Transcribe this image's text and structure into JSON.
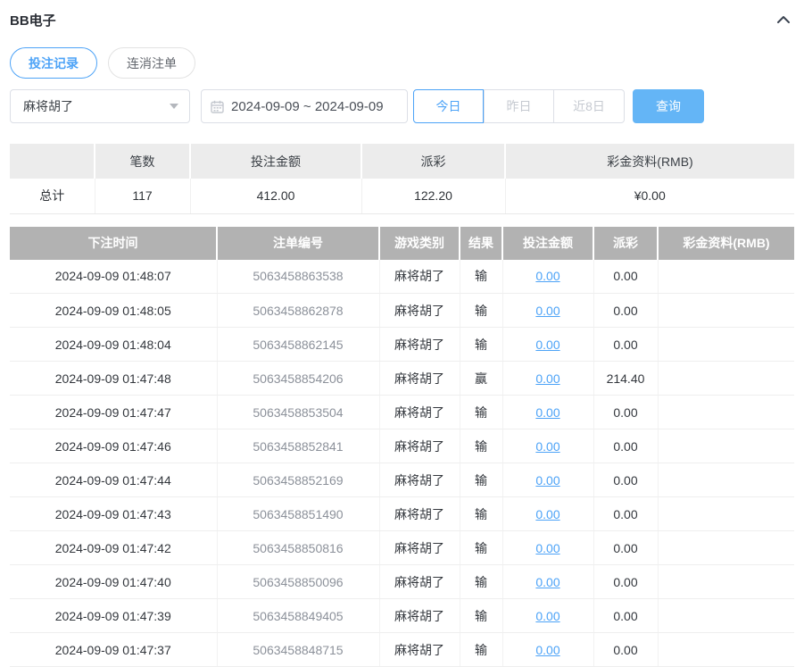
{
  "colors": {
    "accent_blue": "#4da3f7",
    "search_button_blue": "#64b5f6",
    "table_header_gray": "#b2b2b2",
    "summary_header_gray": "#ececec"
  },
  "header": {
    "title": "BB电子",
    "collapse_icon": "chevron-up"
  },
  "tabs": [
    {
      "label": "投注记录",
      "active": true
    },
    {
      "label": "连消注单",
      "active": false
    }
  ],
  "filters": {
    "game_select": {
      "value": "麻将胡了",
      "caret_icon": "caret-down"
    },
    "date_range": {
      "value": "2024-09-09 ~ 2024-09-09",
      "icon": "calendar"
    },
    "quick_buttons": [
      {
        "label": "今日",
        "active": true
      },
      {
        "label": "昨日",
        "active": false
      },
      {
        "label": "近8日",
        "active": false
      }
    ],
    "search_label": "查询"
  },
  "summary": {
    "headers": [
      "",
      "笔数",
      "投注金额",
      "派彩",
      "彩金资料(RMB)"
    ],
    "row": {
      "label": "总计",
      "count": "117",
      "bet_amount": "412.00",
      "payout": "122.20",
      "bonus": "¥0.00"
    }
  },
  "table": {
    "headers": [
      "下注时间",
      "注单编号",
      "游戏类别",
      "结果",
      "投注金额",
      "派彩",
      "彩金资料(RMB)"
    ],
    "rows": [
      {
        "time": "2024-09-09 01:48:07",
        "order_no": "5063458863538",
        "game": "麻将胡了",
        "result": "输",
        "bet": "0.00",
        "payout": "0.00",
        "bonus": ""
      },
      {
        "time": "2024-09-09 01:48:05",
        "order_no": "5063458862878",
        "game": "麻将胡了",
        "result": "输",
        "bet": "0.00",
        "payout": "0.00",
        "bonus": ""
      },
      {
        "time": "2024-09-09 01:48:04",
        "order_no": "5063458862145",
        "game": "麻将胡了",
        "result": "输",
        "bet": "0.00",
        "payout": "0.00",
        "bonus": ""
      },
      {
        "time": "2024-09-09 01:47:48",
        "order_no": "5063458854206",
        "game": "麻将胡了",
        "result": "赢",
        "bet": "0.00",
        "payout": "214.40",
        "bonus": ""
      },
      {
        "time": "2024-09-09 01:47:47",
        "order_no": "5063458853504",
        "game": "麻将胡了",
        "result": "输",
        "bet": "0.00",
        "payout": "0.00",
        "bonus": ""
      },
      {
        "time": "2024-09-09 01:47:46",
        "order_no": "5063458852841",
        "game": "麻将胡了",
        "result": "输",
        "bet": "0.00",
        "payout": "0.00",
        "bonus": ""
      },
      {
        "time": "2024-09-09 01:47:44",
        "order_no": "5063458852169",
        "game": "麻将胡了",
        "result": "输",
        "bet": "0.00",
        "payout": "0.00",
        "bonus": ""
      },
      {
        "time": "2024-09-09 01:47:43",
        "order_no": "5063458851490",
        "game": "麻将胡了",
        "result": "输",
        "bet": "0.00",
        "payout": "0.00",
        "bonus": ""
      },
      {
        "time": "2024-09-09 01:47:42",
        "order_no": "5063458850816",
        "game": "麻将胡了",
        "result": "输",
        "bet": "0.00",
        "payout": "0.00",
        "bonus": ""
      },
      {
        "time": "2024-09-09 01:47:40",
        "order_no": "5063458850096",
        "game": "麻将胡了",
        "result": "输",
        "bet": "0.00",
        "payout": "0.00",
        "bonus": ""
      },
      {
        "time": "2024-09-09 01:47:39",
        "order_no": "5063458849405",
        "game": "麻将胡了",
        "result": "输",
        "bet": "0.00",
        "payout": "0.00",
        "bonus": ""
      },
      {
        "time": "2024-09-09 01:47:37",
        "order_no": "5063458848715",
        "game": "麻将胡了",
        "result": "输",
        "bet": "0.00",
        "payout": "0.00",
        "bonus": ""
      }
    ]
  }
}
